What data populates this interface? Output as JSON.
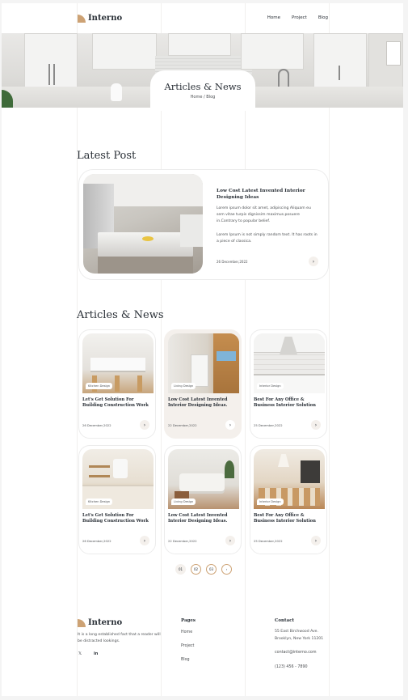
{
  "header": {
    "logo_text": "Interno",
    "nav": [
      "Home",
      "Project",
      "Blog"
    ]
  },
  "hero": {
    "title": "Articles & News",
    "breadcrumb": "Home / Blog"
  },
  "latest": {
    "section_title": "Latest Post",
    "title": "Low Cost Latest Invented Interior Designing Ideas",
    "p1": "Lorem ipsum dolor sit amet, adipiscing Aliquam eu sem vitae turpis dignissim maximus.posuere in.Contrary to popular belief.",
    "p2": "Lorem Ipsum is not simply random text. It has roots in a piece of classica.",
    "date": "26 December,2022",
    "arrow": "›"
  },
  "articles": {
    "section_title": "Articles & News",
    "cards": [
      {
        "tag": "Kitchen Design",
        "title": "Let's Get Solution For Building Construction Work",
        "date": "26 December,2022",
        "arrow": "›"
      },
      {
        "tag": "Living Design",
        "title": "Low Cost Latest Invented Interior Designing Ideas.",
        "date": "22 December,2022",
        "arrow": "›"
      },
      {
        "tag": "Interior Design",
        "title": "Best For Any Office & Business Interior Solution",
        "date": "25 December,2022",
        "arrow": "›"
      },
      {
        "tag": "Kitchen Design",
        "title": "Let's Get Solution For Building Construction Work",
        "date": "26 December,2022",
        "arrow": "›"
      },
      {
        "tag": "Living Design",
        "title": "Low Cost Latest Invented Interior Designing Ideas.",
        "date": "22 December,2022",
        "arrow": "›"
      },
      {
        "tag": "Interior Design",
        "title": "Best For Any Office & Business Interior Solution",
        "date": "25 December,2022",
        "arrow": "›"
      }
    ]
  },
  "pagination": {
    "pages": [
      "01",
      "02",
      "03"
    ],
    "next": "›"
  },
  "footer": {
    "logo_text": "Interno",
    "about": "It is a long established fact that a reader will be distracted lookings.",
    "social": [
      "𝕏",
      "in"
    ],
    "pages_heading": "Pages",
    "pages": [
      "Home",
      "Project",
      "Blog"
    ],
    "contact_heading": "Contact",
    "address_line1": "55 East Birchwood Ave.",
    "address_line2": "Brooklyn, New York 11201",
    "email": "contact@interno.com",
    "phone": "(123) 456 - 7890"
  },
  "colors": {
    "accent": "#cda274",
    "dark": "#292f36",
    "soft": "#f4f0ec"
  },
  "icons": [
    "logo-mark-icon",
    "chevron-right-icon",
    "twitter-icon",
    "linkedin-icon"
  ]
}
